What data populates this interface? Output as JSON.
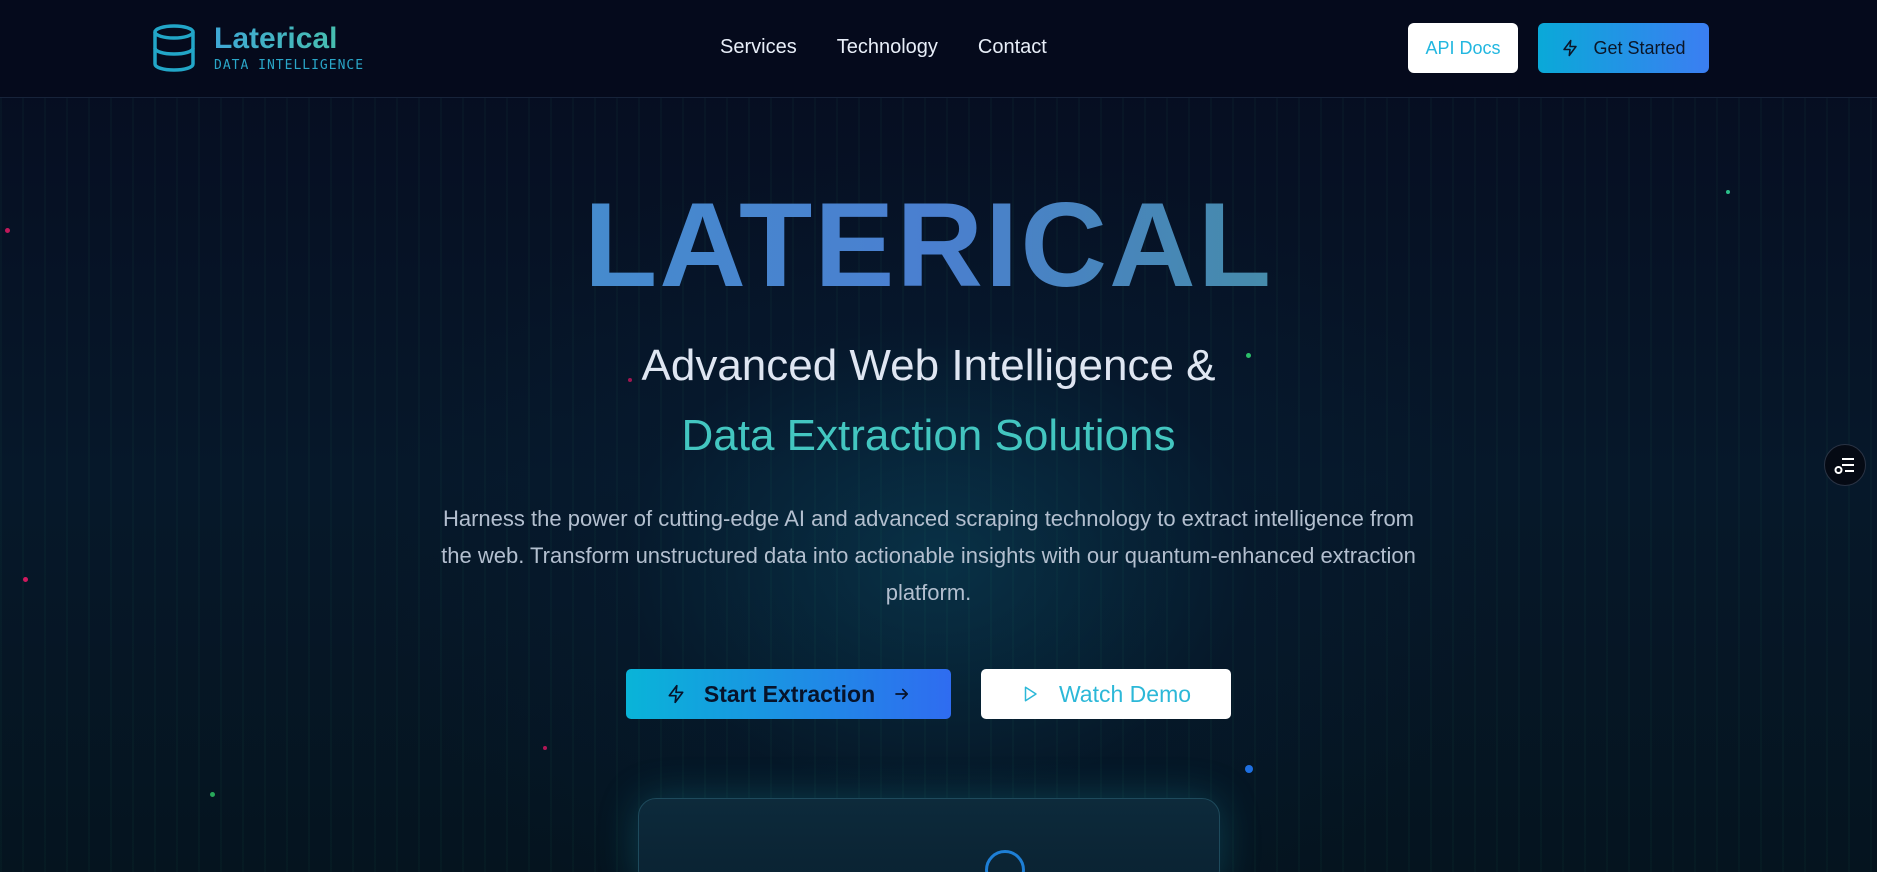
{
  "brand": {
    "name": "Laterical",
    "tagline": "DATA INTELLIGENCE"
  },
  "nav": {
    "items": [
      "Services",
      "Technology",
      "Contact"
    ]
  },
  "header_actions": {
    "api_docs_label": "API Docs",
    "get_started_label": "Get Started"
  },
  "hero": {
    "title": "LATERICAL",
    "subtitle_line1": "Advanced Web Intelligence &",
    "subtitle_line2": "Data Extraction Solutions",
    "description": "Harness the power of cutting-edge AI and advanced scraping technology to extract intelligence from the web. Transform unstructured data into actionable insights with our quantum-enhanced extraction platform.",
    "primary_cta": "Start Extraction",
    "secondary_cta": "Watch Demo"
  },
  "icons": {
    "logo": "database-icon",
    "get_started": "bolt-icon",
    "primary_cta_left": "bolt-icon",
    "primary_cta_right": "arrow-right-icon",
    "secondary_cta": "play-icon",
    "floating": "list-settings-icon"
  },
  "colors": {
    "background": "#030818",
    "accent_cyan": "#22b7e0",
    "accent_teal": "#43c6c0",
    "accent_blue": "#3b7ef2"
  }
}
